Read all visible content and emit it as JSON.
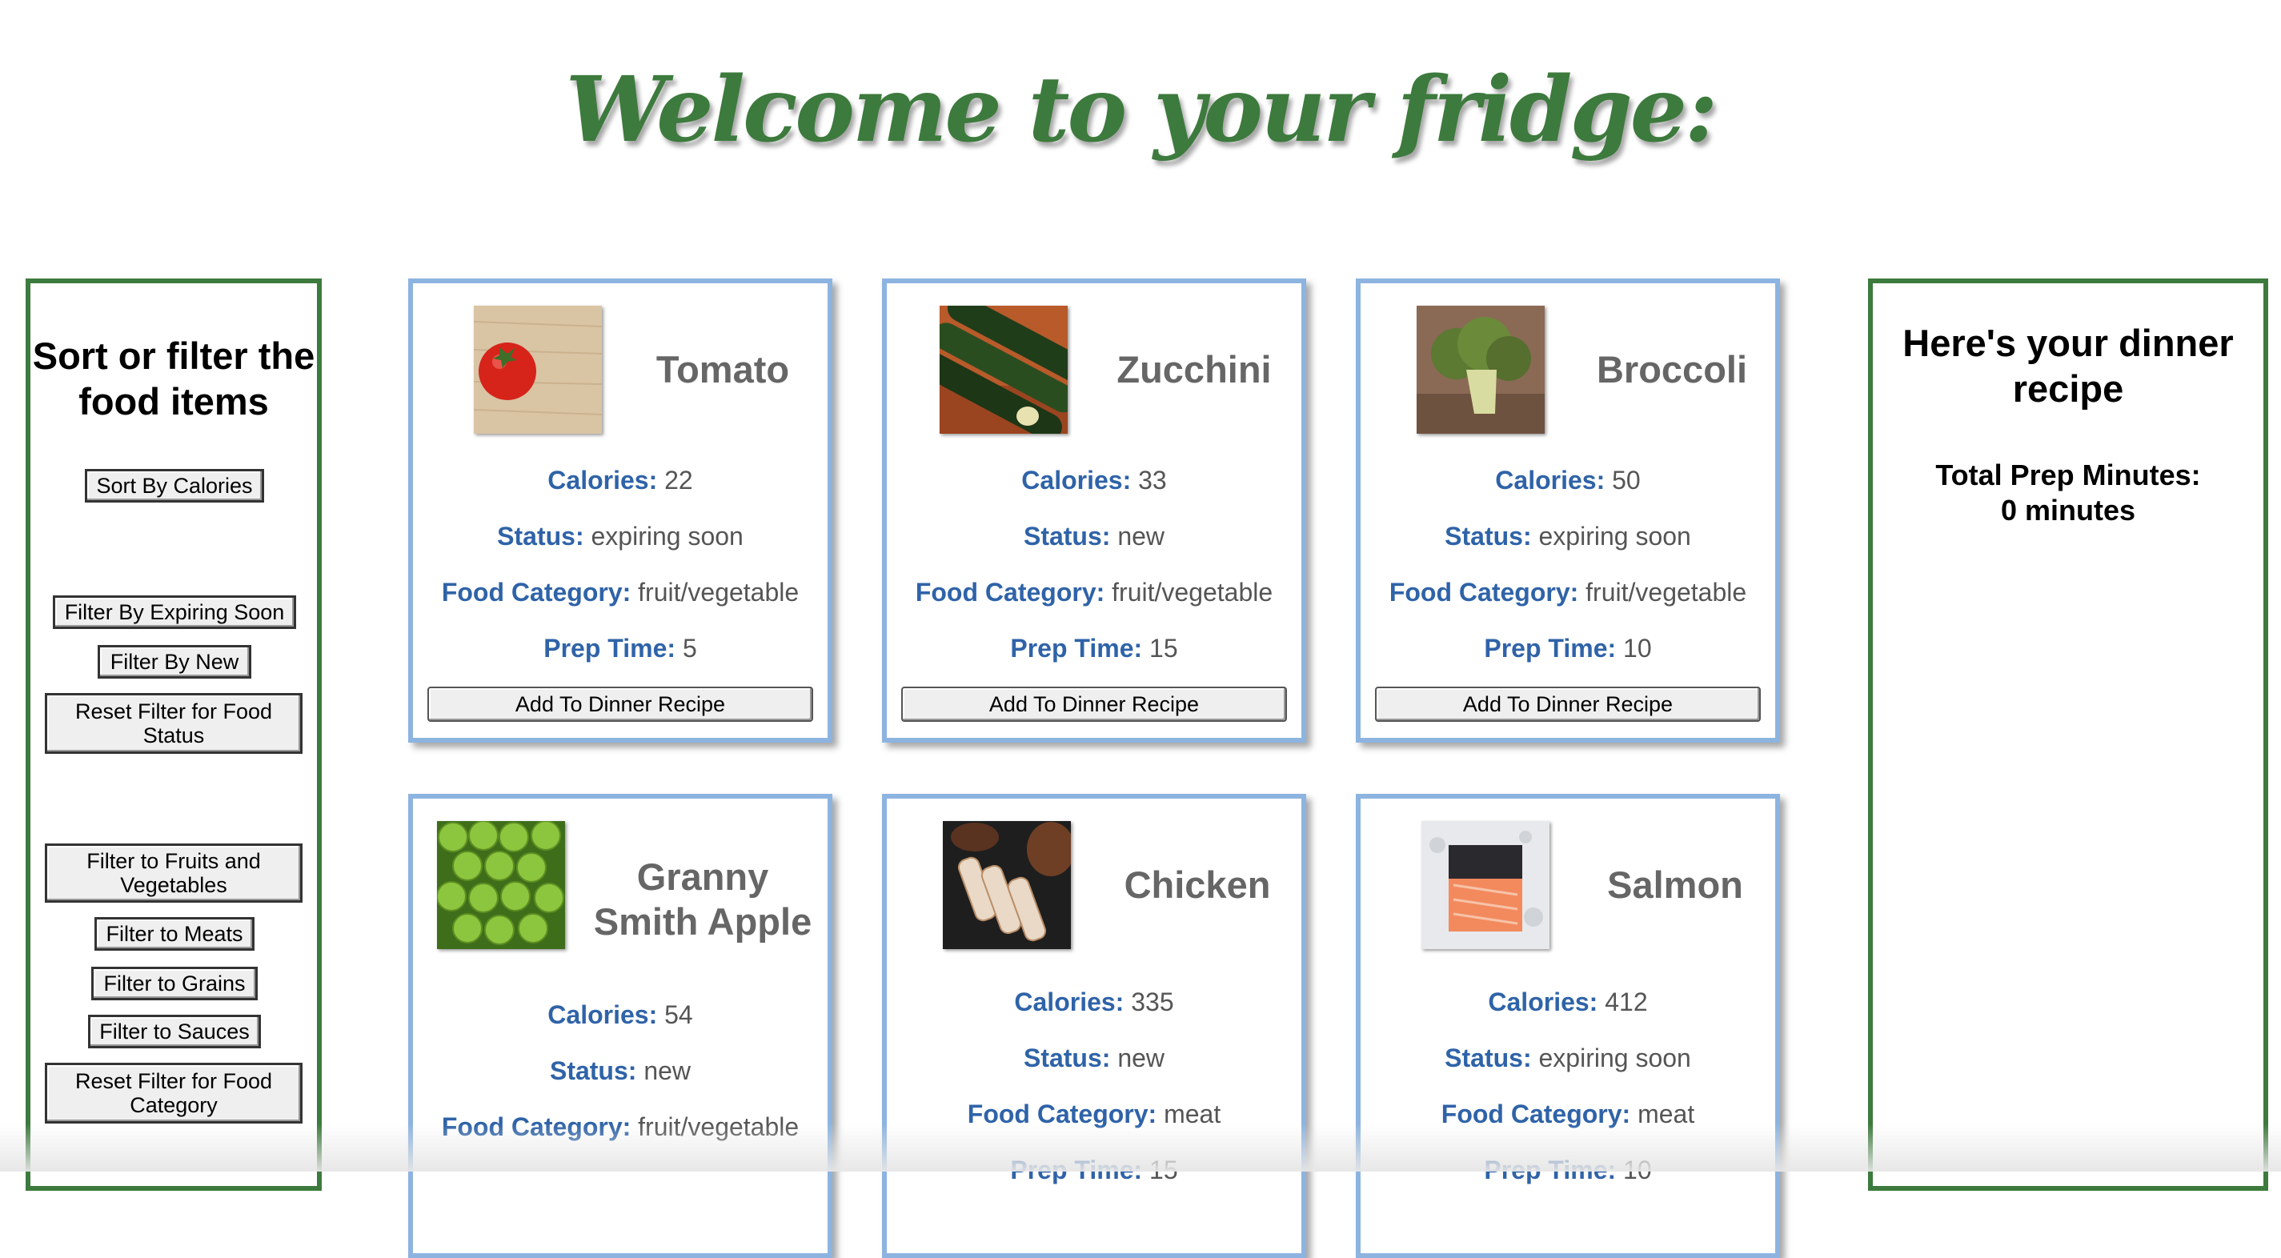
{
  "page": {
    "title": "Welcome to your fridge:"
  },
  "left_panel": {
    "heading": "Sort or filter the food items",
    "buttons": {
      "sort_calories": "Sort By Calories",
      "filter_expiring": "Filter By Expiring Soon",
      "filter_new": "Filter By New",
      "reset_status": "Reset Filter for Food Status",
      "filter_fruits_veg": "Filter to Fruits and Vegetables",
      "filter_meats": "Filter to Meats",
      "filter_grains": "Filter to Grains",
      "filter_sauces": "Filter to Sauces",
      "reset_category": "Reset Filter for Food Category"
    }
  },
  "right_panel": {
    "heading": "Here's your dinner recipe",
    "prep_label": "Total Prep Minutes:",
    "prep_value": "0 minutes"
  },
  "labels": {
    "calories": "Calories:",
    "status": "Status:",
    "category": "Food Category:",
    "prep": "Prep Time:",
    "add_button": "Add To Dinner Recipe"
  },
  "foods": [
    {
      "name": "Tomato",
      "calories": "22",
      "status": "expiring soon",
      "category": "fruit/vegetable",
      "prep": "5",
      "icon": "tomato-image"
    },
    {
      "name": "Zucchini",
      "calories": "33",
      "status": "new",
      "category": "fruit/vegetable",
      "prep": "15",
      "icon": "zucchini-image"
    },
    {
      "name": "Broccoli",
      "calories": "50",
      "status": "expiring soon",
      "category": "fruit/vegetable",
      "prep": "10",
      "icon": "broccoli-image"
    },
    {
      "name": "Granny Smith Apple",
      "calories": "54",
      "status": "new",
      "category": "fruit/vegetable",
      "prep": "",
      "icon": "apple-image"
    },
    {
      "name": "Chicken",
      "calories": "335",
      "status": "new",
      "category": "meat",
      "prep": "15",
      "icon": "chicken-image"
    },
    {
      "name": "Salmon",
      "calories": "412",
      "status": "expiring soon",
      "category": "meat",
      "prep": "10",
      "icon": "salmon-image"
    }
  ]
}
